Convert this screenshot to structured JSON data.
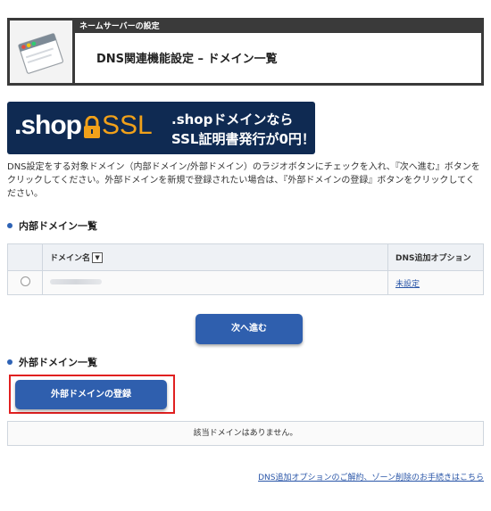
{
  "header": {
    "bar_label": "ネームサーバーの設定",
    "title": "DNS関連機能設定 – ドメイン一覧",
    "icon": "browser-window-icon"
  },
  "banner": {
    "logo_text": ".shop",
    "ssl_text": "SSL",
    "line1": ".shopドメインなら",
    "line2": "SSL証明書発行が0円！",
    "lock_icon": "padlock-icon",
    "colors": {
      "background": "#0f2a52",
      "accent": "#f1a11a"
    }
  },
  "description": "DNS設定をする対象ドメイン（内部ドメイン/外部ドメイン）のラジオボタンにチェックを入れ、『次へ進む』ボタンをクリックしてください。外部ドメインを新規で登録されたい場合は、『外部ドメインの登録』ボタンをクリックしてください。",
  "internal": {
    "title": "内部ドメイン一覧",
    "columns": {
      "domain": "ドメイン名",
      "dns_option": "DNS追加オプション"
    },
    "rows": [
      {
        "domain": "",
        "option": "未設定"
      }
    ],
    "next_button": "次へ進む"
  },
  "external": {
    "title": "外部ドメイン一覧",
    "register_button": "外部ドメインの登録",
    "empty_message": "該当ドメインはありません。"
  },
  "footer_link": "DNS追加オプションのご解約、ゾーン削除のお手続きはこちら",
  "colors": {
    "primary_button": "#2f5fae",
    "highlight": "#e02020",
    "bullet": "#2e63b5"
  }
}
